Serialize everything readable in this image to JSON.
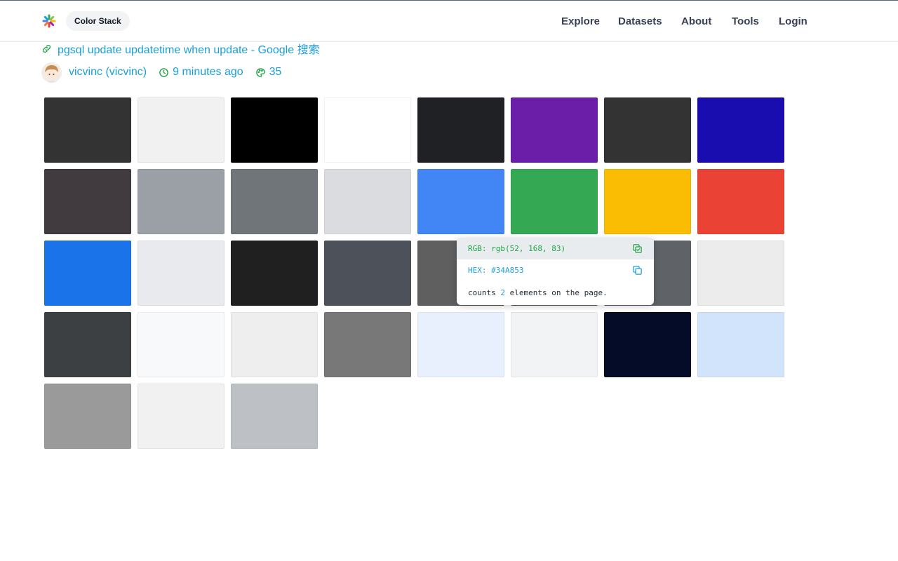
{
  "header": {
    "brand": "Color Stack",
    "nav": [
      "Explore",
      "Datasets",
      "About",
      "Tools",
      "Login"
    ]
  },
  "page": {
    "title": "pgsql update updatetime when update - Google 搜索",
    "author": "vicvinc (vicvinc)",
    "time_ago": "9 minutes ago",
    "color_count": "35"
  },
  "swatches": [
    [
      "#333333",
      "#f1f1f1",
      "#000000",
      "#ffffff",
      "#202124",
      "#6b1fa8",
      "#333333",
      "#1a0db0"
    ],
    [
      "#413a3e",
      "#9aa0a6",
      "#70757a",
      "#dadce0",
      "#4285f4",
      "#34a853",
      "#fbbc04",
      "#ea4335"
    ],
    [
      "#1a73e8",
      "#e8eaed",
      "#202020",
      "#4d5159",
      "#5f5f5f",
      "#5f6368",
      "#5f6368",
      "#ececec"
    ],
    [
      "#3c4043",
      "#f8f9fa",
      "#eeeeee",
      "#787878",
      "#e8f0fe",
      "#f1f3f4",
      "#040c28",
      "#d2e3fc"
    ],
    [
      "#9a9a9a",
      "#f1f1f1",
      "#bdc1c6"
    ]
  ],
  "tooltip": {
    "rgb_label": "RGB: rgb(52, 168, 83)",
    "hex_label": "HEX: #34A853",
    "count_prefix": "counts",
    "count_value": "2",
    "count_suffix": "elements on the page."
  },
  "icons": {
    "logo": "color-wheel-icon",
    "title": "link-icon",
    "time": "clock-icon",
    "count": "palette-icon",
    "copied": "copy-check-icon",
    "copy": "copy-icon"
  }
}
